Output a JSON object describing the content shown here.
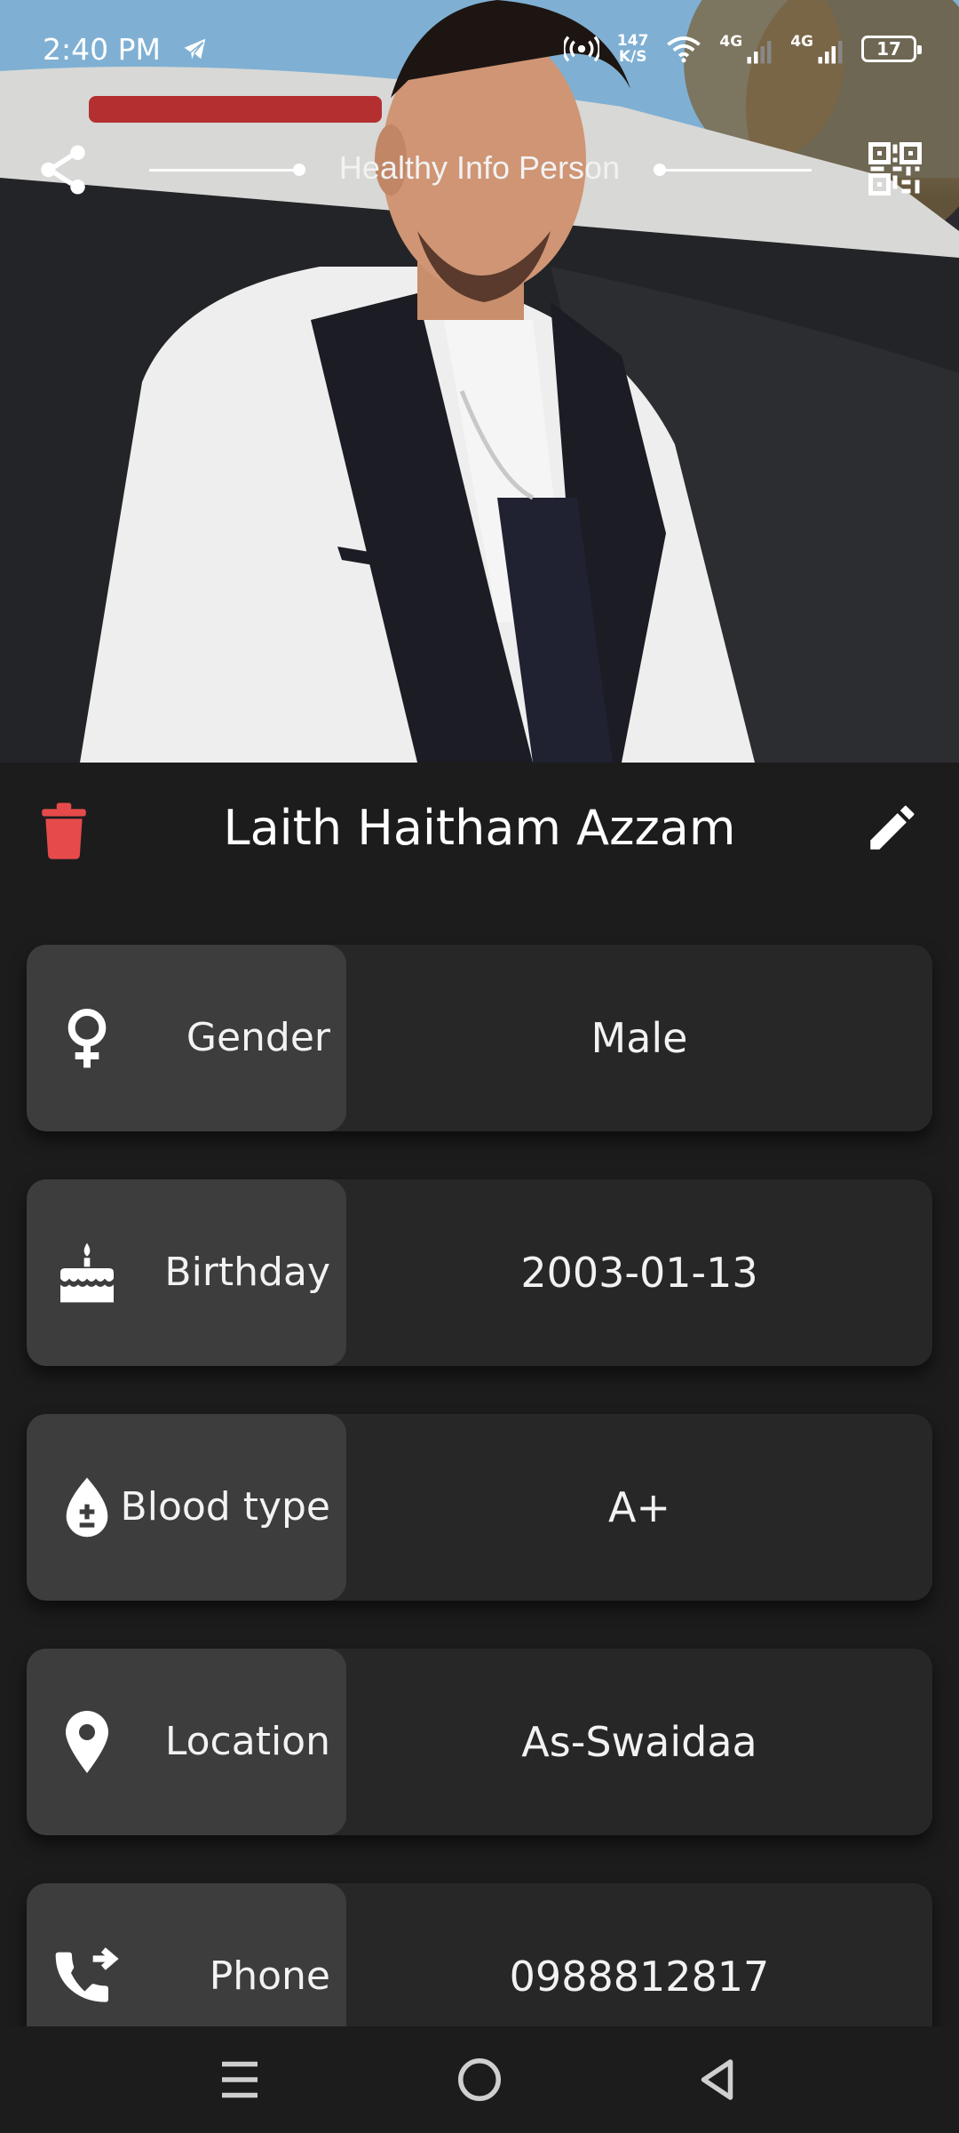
{
  "status_bar": {
    "time": "2:40 PM",
    "speed_value": "147",
    "speed_unit": "K/S",
    "network_1": "4G",
    "network_2": "4G",
    "battery": "17",
    "icons": [
      "telegram-icon",
      "hotspot-icon",
      "wifi-icon",
      "signal-icon",
      "battery-icon"
    ]
  },
  "header": {
    "title": "Healthy Info Person",
    "share_icon": "share-icon",
    "qr_icon": "qr-code-icon"
  },
  "profile": {
    "name": "Laith Haitham Azzam",
    "delete_icon": "trash-icon",
    "edit_icon": "pencil-icon",
    "delete_color": "#e74a4a"
  },
  "info": [
    {
      "icon": "female-symbol-icon",
      "label": "Gender",
      "value": "Male"
    },
    {
      "icon": "birthday-cake-icon",
      "label": "Birthday",
      "value": "2003-01-13"
    },
    {
      "icon": "blood-drop-icon",
      "label": "Blood type",
      "value": "A+"
    },
    {
      "icon": "location-pin-icon",
      "label": "Location",
      "value": "As-Swaidaa"
    },
    {
      "icon": "phone-forward-icon",
      "label": "Phone",
      "value": "0988812817"
    }
  ],
  "nav": [
    "menu-icon",
    "home-icon",
    "back-icon"
  ],
  "colors": {
    "background": "#1c1c1c",
    "card": "#272727",
    "label_box": "#3d3d3d",
    "delete": "#e74a4a"
  }
}
